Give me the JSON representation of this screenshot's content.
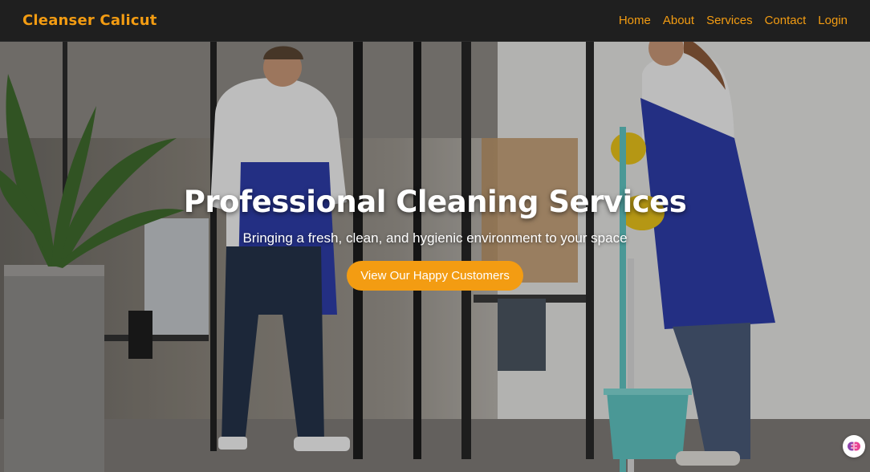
{
  "brand": "Cleanser Calicut",
  "nav": [
    {
      "label": "Home"
    },
    {
      "label": "About"
    },
    {
      "label": "Services"
    },
    {
      "label": "Contact"
    },
    {
      "label": "Login"
    }
  ],
  "hero": {
    "title": "Professional Cleaning Services",
    "subtitle": "Bringing a fresh, clean, and hygienic environment to your space",
    "cta_label": "View Our Happy Customers",
    "image": "photo of two cleaners wearing blue aprons in a glass-walled office"
  },
  "colors": {
    "accent": "#f39c12",
    "navbar_bg": "#1f1f1f",
    "apron": "#2e3da8",
    "glove": "#e8c21a",
    "bucket": "#5fc3c0"
  },
  "icons": {
    "assistant": "brain-icon"
  }
}
